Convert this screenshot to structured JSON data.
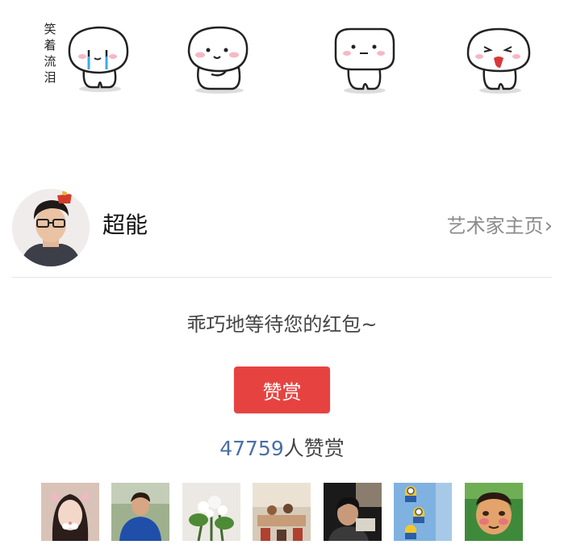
{
  "stickers": {
    "caption_chars": [
      "笑",
      "着",
      "流",
      "泪"
    ],
    "items": [
      "crying-bun-sticker",
      "shy-bun-sticker",
      "smiling-bun-sticker",
      "tongue-bun-sticker"
    ]
  },
  "artist": {
    "name": "超能",
    "homepage_label": "艺术家主页",
    "chevron": "›"
  },
  "reward": {
    "message": "乖巧地等待您的红包~",
    "button_label": "赞赏",
    "count": "47759",
    "count_suffix": "人赞赏",
    "accent_color": "#e64340",
    "count_color": "#4a6fa5"
  },
  "rewarders": [
    {
      "icon": "girl-cat-filter-avatar"
    },
    {
      "icon": "woman-blue-shirt-avatar"
    },
    {
      "icon": "flowers-avatar"
    },
    {
      "icon": "family-room-avatar"
    },
    {
      "icon": "man-reading-avatar"
    },
    {
      "icon": "minions-avatar"
    },
    {
      "icon": "funny-face-avatar"
    }
  ]
}
